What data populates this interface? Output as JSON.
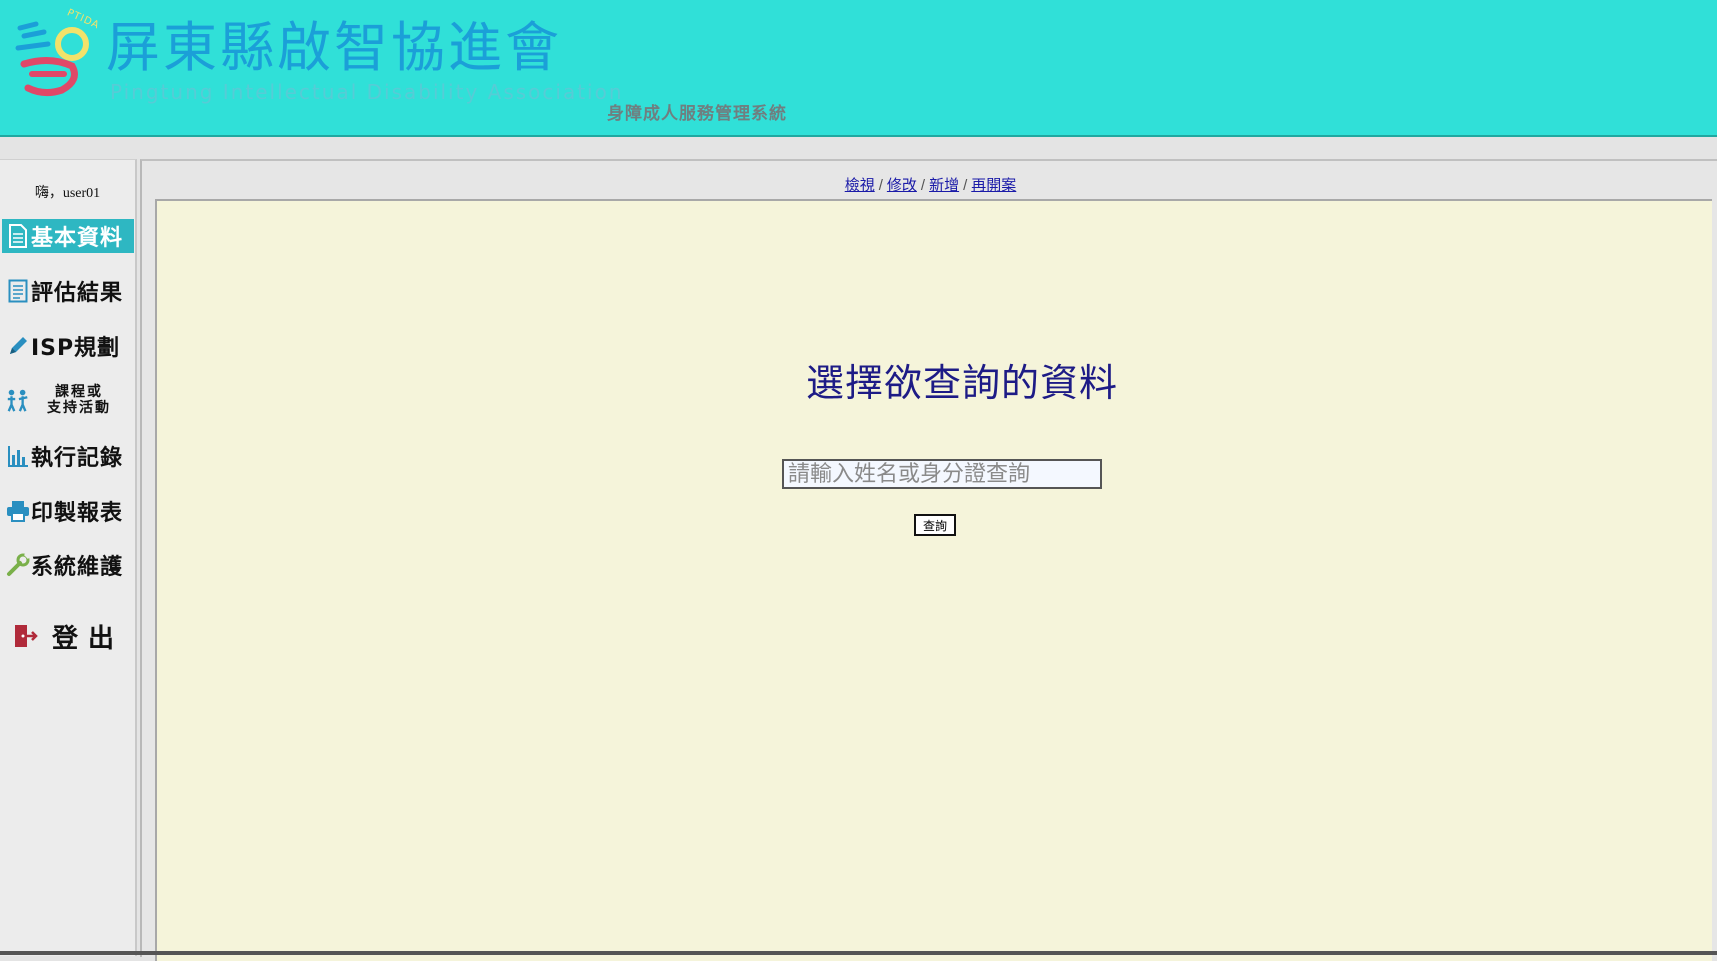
{
  "header": {
    "org_name": "屏東縣啟智協進會",
    "org_name_en": "Pingtung Intellectual Disability Association",
    "org_acronym": "PTIDA",
    "system_name": "身障成人服務管理系統",
    "background_color": "#30e0d8"
  },
  "sidebar": {
    "greeting": "嗨，user01",
    "items": [
      {
        "label": "基本資料",
        "icon": "document-icon",
        "active": true
      },
      {
        "label": "評估結果",
        "icon": "checklist-icon",
        "active": false
      },
      {
        "label": "ISP規劃",
        "icon": "pencil-icon",
        "active": false
      },
      {
        "label_line1": "課程或",
        "label_line2": "支持活動",
        "icon": "people-activity-icon",
        "active": false
      },
      {
        "label": "執行記錄",
        "icon": "bar-chart-icon",
        "active": false
      },
      {
        "label": "印製報表",
        "icon": "printer-icon",
        "active": false
      },
      {
        "label": "系統維護",
        "icon": "wrench-icon",
        "active": false
      }
    ],
    "logout_label": "登出",
    "logout_icon": "exit-door-icon",
    "active_color": "#2eb7c2"
  },
  "main": {
    "view_links": [
      "檢視",
      "修改",
      "新增",
      "再開案"
    ],
    "query_heading": "選擇欲查詢的資料",
    "search_placeholder": "請輸入姓名或身分證查詢",
    "search_value": "",
    "search_button_label": "查詢",
    "content_background": "#f5f4da"
  }
}
